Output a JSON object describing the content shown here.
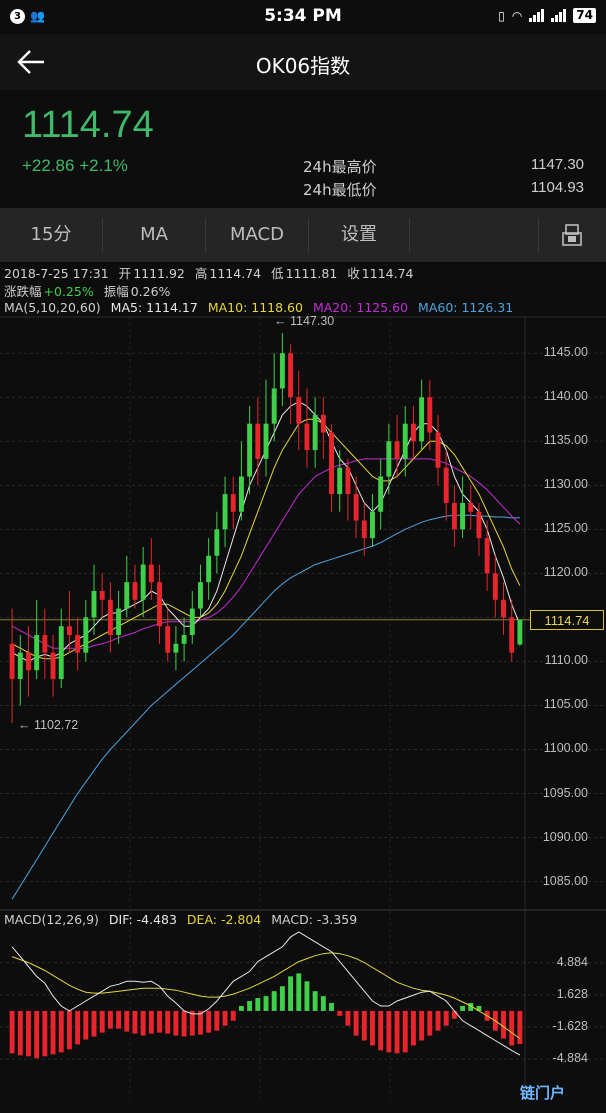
{
  "status_bar": {
    "time": "5:34 PM",
    "notifications": "3",
    "battery": "74"
  },
  "nav": {
    "title": "OK06指数"
  },
  "price": {
    "last": "1114.74",
    "change": "+22.86",
    "change_pct": "+2.1%",
    "high_label": "24h最高价",
    "high_value": "1147.30",
    "low_label": "24h最低价",
    "low_value": "1104.93"
  },
  "toolbar": {
    "interval": "15分",
    "ma": "MA",
    "macd": "MACD",
    "settings": "设置"
  },
  "candle_info": {
    "datetime": "2018-7-25 17:31",
    "open_label": "开",
    "open": "1111.92",
    "high_label": "高",
    "high": "1114.74",
    "low_label": "低",
    "low": "1111.81",
    "close_label": "收",
    "close": "1114.74",
    "change_label": "涨跌幅",
    "change": "+0.25%",
    "amp_label": "振幅",
    "amp": "0.26%"
  },
  "ma_legend": {
    "title": "MA(5,10,20,60)",
    "ma5": "MA5: 1114.17",
    "ma10": "MA10: 1118.60",
    "ma20": "MA20: 1125.60",
    "ma60": "MA60: 1126.31"
  },
  "macd_legend": {
    "title": "MACD(12,26,9)",
    "dif": "DIF: -4.483",
    "dea": "DEA: -2.804",
    "macd": "MACD: -3.359"
  },
  "colors": {
    "up": "#3fd04a",
    "down": "#e8242c",
    "ma5": "#e8e8e8",
    "ma10": "#e6d63a",
    "ma20": "#c42bd6",
    "ma60": "#4ea3e0",
    "price_green": "#3fb96a"
  },
  "chart_data": [
    {
      "type": "candlestick",
      "y_ticks": [
        "1145.00",
        "1140.00",
        "1135.00",
        "1130.00",
        "1125.00",
        "1120.00",
        "1115.00",
        "1110.00",
        "1105.00",
        "1100.00",
        "1095.00",
        "1090.00",
        "1085.00"
      ],
      "ylim": [
        1082,
        1149
      ],
      "current_price": "1114.74",
      "annotations": {
        "max": "← 1147.30",
        "min": "← 1102.72"
      },
      "candles": [
        [
          1112,
          1108,
          1116,
          1103
        ],
        [
          1108,
          1111,
          1113,
          1105
        ],
        [
          1111,
          1109,
          1114,
          1106
        ],
        [
          1109,
          1113,
          1117,
          1108
        ],
        [
          1113,
          1111,
          1116,
          1108
        ],
        [
          1111,
          1108,
          1113,
          1106
        ],
        [
          1108,
          1114,
          1116,
          1107
        ],
        [
          1114,
          1113,
          1118,
          1111
        ],
        [
          1113,
          1111,
          1115,
          1109
        ],
        [
          1111,
          1115,
          1117,
          1110
        ],
        [
          1115,
          1118,
          1121,
          1113
        ],
        [
          1118,
          1117,
          1120,
          1115
        ],
        [
          1117,
          1113,
          1119,
          1111
        ],
        [
          1113,
          1116,
          1118,
          1112
        ],
        [
          1116,
          1119,
          1122,
          1115
        ],
        [
          1119,
          1117,
          1121,
          1116
        ],
        [
          1117,
          1121,
          1123,
          1115
        ],
        [
          1121,
          1119,
          1124,
          1117
        ],
        [
          1119,
          1114,
          1121,
          1112
        ],
        [
          1114,
          1111,
          1116,
          1110
        ],
        [
          1111,
          1112,
          1114,
          1109
        ],
        [
          1112,
          1113,
          1115,
          1110
        ],
        [
          1113,
          1116,
          1118,
          1112
        ],
        [
          1116,
          1119,
          1121,
          1115
        ],
        [
          1119,
          1122,
          1124,
          1117
        ],
        [
          1122,
          1125,
          1127,
          1120
        ],
        [
          1125,
          1129,
          1131,
          1123
        ],
        [
          1129,
          1127,
          1131,
          1125
        ],
        [
          1127,
          1131,
          1135,
          1126
        ],
        [
          1131,
          1137,
          1139,
          1129
        ],
        [
          1137,
          1133,
          1140,
          1130
        ],
        [
          1133,
          1137,
          1142,
          1131
        ],
        [
          1137,
          1141,
          1145,
          1135
        ],
        [
          1141,
          1145,
          1147.3,
          1139
        ],
        [
          1145,
          1140,
          1146,
          1137
        ],
        [
          1140,
          1137,
          1143,
          1134
        ],
        [
          1137,
          1134,
          1141,
          1132
        ],
        [
          1134,
          1138,
          1140,
          1132
        ],
        [
          1138,
          1136,
          1140,
          1133
        ],
        [
          1136,
          1129,
          1137,
          1127
        ],
        [
          1129,
          1132,
          1134,
          1127
        ],
        [
          1132,
          1129,
          1133,
          1126
        ],
        [
          1129,
          1126,
          1131,
          1124
        ],
        [
          1126,
          1124,
          1128,
          1122
        ],
        [
          1124,
          1127,
          1129,
          1123
        ],
        [
          1127,
          1131,
          1133,
          1125
        ],
        [
          1131,
          1135,
          1137,
          1129
        ],
        [
          1135,
          1133,
          1138,
          1131
        ],
        [
          1133,
          1137,
          1139,
          1131
        ],
        [
          1137,
          1135,
          1139,
          1133
        ],
        [
          1135,
          1140,
          1142,
          1134
        ],
        [
          1140,
          1136,
          1142,
          1134
        ],
        [
          1136,
          1132,
          1138,
          1130
        ],
        [
          1132,
          1128,
          1134,
          1126
        ],
        [
          1128,
          1125,
          1130,
          1123
        ],
        [
          1125,
          1128,
          1131,
          1124
        ],
        [
          1128,
          1127,
          1130,
          1125
        ],
        [
          1127,
          1124,
          1128,
          1122
        ],
        [
          1124,
          1120,
          1126,
          1118
        ],
        [
          1120,
          1117,
          1122,
          1115
        ],
        [
          1117,
          1115,
          1119,
          1113
        ],
        [
          1115,
          1111,
          1117,
          1110
        ],
        [
          1111.92,
          1114.74,
          1114.74,
          1111.81
        ]
      ],
      "ma5": [
        1111,
        1110.5,
        1110,
        1110.5,
        1110.8,
        1110.5,
        1111,
        1112,
        1112.5,
        1113,
        1114,
        1115,
        1115.5,
        1115.5,
        1116,
        1116.5,
        1117,
        1118,
        1117.5,
        1116,
        1115,
        1114,
        1114,
        1115,
        1116,
        1118,
        1121,
        1124,
        1127,
        1130,
        1132,
        1134,
        1136,
        1138,
        1139,
        1139.5,
        1139,
        1138,
        1137,
        1135,
        1133,
        1132,
        1130,
        1128,
        1127,
        1128,
        1130,
        1132,
        1134,
        1136,
        1137,
        1137,
        1136,
        1134,
        1131,
        1129,
        1128,
        1127,
        1125,
        1122,
        1119.5,
        1116.5,
        1114.17
      ],
      "ma10": [
        1112,
        1111.5,
        1111,
        1110.5,
        1110.3,
        1110.3,
        1110.5,
        1111,
        1111.5,
        1112,
        1112.5,
        1113,
        1113.5,
        1114,
        1114.5,
        1115,
        1115.5,
        1116,
        1116.5,
        1116.5,
        1116,
        1115.5,
        1115,
        1115,
        1115.5,
        1116.5,
        1118,
        1120,
        1122,
        1124.5,
        1127,
        1129.5,
        1132,
        1134,
        1135.5,
        1137,
        1137.5,
        1137.5,
        1137,
        1136,
        1135,
        1134,
        1133,
        1132,
        1131,
        1130.5,
        1130.5,
        1131,
        1132,
        1133,
        1134,
        1135,
        1135,
        1134.5,
        1133.5,
        1132,
        1130.5,
        1129,
        1127,
        1125,
        1123,
        1120.5,
        1118.6
      ],
      "ma20": [
        1114,
        1113.5,
        1113,
        1112.5,
        1112,
        1111.5,
        1111.5,
        1111.5,
        1111.5,
        1111.5,
        1111.8,
        1112,
        1112.3,
        1112.7,
        1113,
        1113.3,
        1113.7,
        1114,
        1114.3,
        1114.5,
        1114.5,
        1114.5,
        1114.5,
        1114.7,
        1115,
        1115.5,
        1116.3,
        1117.3,
        1118.5,
        1120,
        1121.5,
        1123,
        1124.5,
        1126,
        1127.5,
        1129,
        1130,
        1131,
        1131.5,
        1132,
        1132.3,
        1132.5,
        1132.8,
        1133,
        1133,
        1133,
        1133,
        1133,
        1133,
        1133,
        1133,
        1133,
        1132.8,
        1132.5,
        1132,
        1131.5,
        1131,
        1130.3,
        1129.5,
        1128.5,
        1127.5,
        1126.5,
        1125.6
      ],
      "ma60": [
        1083,
        1084.5,
        1086,
        1087.5,
        1089,
        1090.5,
        1092,
        1093.5,
        1095,
        1096.3,
        1097.6,
        1098.9,
        1100,
        1101,
        1102,
        1103,
        1104,
        1105,
        1105.8,
        1106.6,
        1107.4,
        1108.2,
        1109,
        1109.8,
        1110.6,
        1111.4,
        1112.2,
        1113,
        1114,
        1115,
        1116,
        1117,
        1118,
        1118.8,
        1119.5,
        1120,
        1120.5,
        1121,
        1121.3,
        1121.6,
        1121.9,
        1122.2,
        1122.5,
        1122.8,
        1123.1,
        1123.5,
        1124,
        1124.5,
        1125,
        1125.4,
        1125.8,
        1126.1,
        1126.3,
        1126.5,
        1126.6,
        1126.6,
        1126.6,
        1126.5,
        1126.5,
        1126.4,
        1126.4,
        1126.3,
        1126.31
      ]
    },
    {
      "type": "macd",
      "y_ticks": [
        "4.884",
        "1.628",
        "-1.628",
        "-4.884"
      ],
      "ylim": [
        -6.8,
        8.2
      ],
      "dif": [
        6.5,
        5.5,
        4.5,
        3.5,
        2.8,
        1.5,
        0.5,
        0,
        0.5,
        1,
        1.5,
        2,
        2.5,
        2.7,
        3,
        3,
        2.9,
        3,
        2.5,
        1.5,
        0.8,
        0,
        -0.3,
        -0.3,
        0.2,
        1,
        2,
        3,
        3.5,
        4,
        5,
        5.5,
        6,
        6.5,
        7.5,
        8,
        7.5,
        7,
        6.5,
        6,
        5,
        4,
        3,
        2,
        1,
        0.5,
        0.5,
        1,
        1.3,
        1.6,
        1.9,
        2,
        1.5,
        1,
        0,
        -1,
        -1.5,
        -2,
        -2.5,
        -3,
        -3.5,
        -4,
        -4.483
      ],
      "dea": [
        5.5,
        5.2,
        4.9,
        4.5,
        4.1,
        3.6,
        3.1,
        2.6,
        2.2,
        1.9,
        1.8,
        1.8,
        1.9,
        2,
        2.1,
        2.2,
        2.3,
        2.3,
        2.3,
        2.2,
        2.1,
        1.9,
        1.7,
        1.5,
        1.4,
        1.4,
        1.5,
        1.7,
        2,
        2.3,
        2.7,
        3.1,
        3.5,
        4,
        4.5,
        5,
        5.3,
        5.6,
        5.8,
        5.9,
        5.8,
        5.6,
        5.3,
        4.9,
        4.4,
        3.9,
        3.4,
        2.9,
        2.6,
        2.3,
        2.1,
        2,
        1.8,
        1.6,
        1.3,
        0.9,
        0.5,
        0,
        -0.5,
        -1,
        -1.6,
        -2.2,
        -2.804
      ],
      "macd": [
        -4.3,
        -4.5,
        -4.6,
        -4.8,
        -4.6,
        -4.4,
        -4.2,
        -3.9,
        -3.4,
        -2.9,
        -2.6,
        -2.2,
        -1.8,
        -1.8,
        -2.1,
        -2.3,
        -2.5,
        -2.3,
        -2.2,
        -2.3,
        -2.5,
        -2.6,
        -2.5,
        -2.4,
        -2.2,
        -2,
        -1.5,
        -1,
        0.5,
        1,
        1.3,
        1.5,
        2,
        2.5,
        3.5,
        3.8,
        3,
        2,
        1.5,
        0.8,
        -0.5,
        -1.5,
        -2.5,
        -3,
        -3.5,
        -4,
        -4.2,
        -4.3,
        -4.2,
        -3.5,
        -3,
        -2.5,
        -2,
        -1.5,
        -0.8,
        0.5,
        0.8,
        0.5,
        -1,
        -2,
        -2.8,
        -3.5,
        -3.359
      ]
    }
  ],
  "watermark": "链门户"
}
